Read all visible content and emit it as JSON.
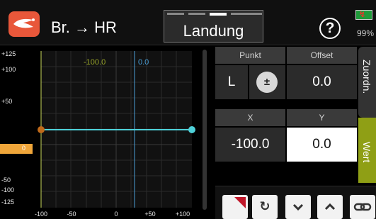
{
  "header": {
    "app_icon": "airplane-icon",
    "title": "Br. → HR",
    "mode_label": "Landung",
    "help_label": "?",
    "battery_percent": "99%",
    "battery_icon": "battery-charging-icon"
  },
  "graph": {
    "y_labels": [
      "+125",
      "+100",
      "+50",
      "0",
      "-50",
      "-100",
      "-125"
    ],
    "x_labels": [
      "-100",
      "-50",
      "0",
      "+50",
      "+100"
    ],
    "top_values": {
      "x_value": "-100.0",
      "y_value": "0.0"
    },
    "colors": {
      "curve": "#4fd1d9",
      "point_left": "#c06a1a",
      "point_right": "#4fd1d9",
      "x_guide": "#c8d85a",
      "y_guide": "#4aa0d8"
    }
  },
  "panel": {
    "punkt_header": "Punkt",
    "offset_header": "Offset",
    "punkt_value": "L",
    "punkt_icon": "plus-minus-icon",
    "offset_value": "0.0",
    "x_header": "X",
    "y_header": "Y",
    "x_value": "-100.0",
    "y_value": "0.0"
  },
  "side_tabs": {
    "zuord": "Zuordn.",
    "wert": "Wert"
  },
  "toolbar": {
    "buttons": [
      "corner-marker-icon",
      "refresh-icon",
      "chevron-down-icon",
      "chevron-up-icon",
      "link-icon"
    ]
  }
}
